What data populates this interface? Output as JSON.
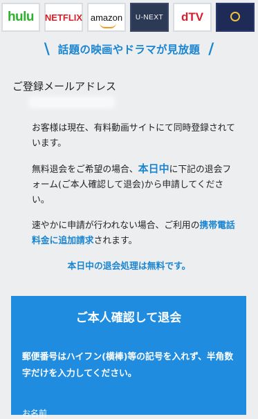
{
  "logos": {
    "hulu": "hulu",
    "netflix": "NETFLIX",
    "amazon": "amazon",
    "unext": "U-NEXT",
    "dtv": "dTV"
  },
  "headline": "話題の映画やドラマが見放題",
  "email": {
    "label": "ご登録メールアドレス"
  },
  "notice": {
    "p1": "お客様は現在、有料動画サイトにて同時登録されています。",
    "p2_pre": "無料退会をご希望の場合、",
    "p2_highlight": "本日中",
    "p2_post": "に下記の退会フォーム(ご本人確認して退会)から申請してください。",
    "p3_pre": "速やかに申請が行われない場合、ご利用の",
    "p3_highlight": "携帯電話料金に追加請求",
    "p3_post": "されます。",
    "free_note": "本日中の退会処理は無料です。"
  },
  "form": {
    "title": "ご本人確認して退会",
    "note": "郵便番号はハイフン(横棒)等の記号を入れず、半角数字だけを入力してください。",
    "name_label": "お名前"
  },
  "colors": {
    "accent": "#1a85d0",
    "panel": "#1f8ce0",
    "background": "#eceef0"
  }
}
